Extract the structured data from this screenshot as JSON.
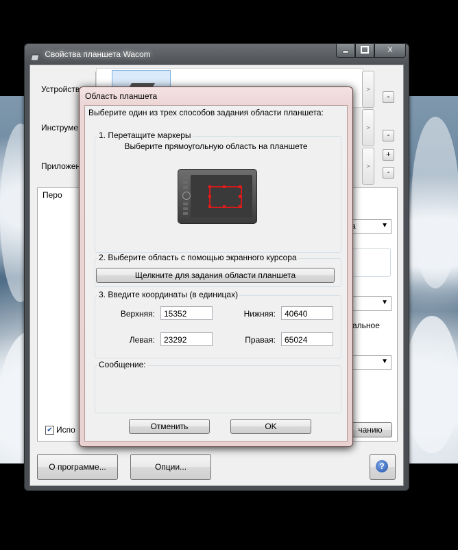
{
  "main_window": {
    "title": "Свойства планшета Wacom",
    "close_label": "X",
    "rows": {
      "device_label": "Устройство",
      "tool_label": "Инструмент",
      "app_label": "Приложение"
    },
    "nav_arrow": ">",
    "minus": "-",
    "plus": "+",
    "tab_pen_label": "Перо",
    "partial_a": "а",
    "partial_normal": "альное",
    "checkbox_checked": true,
    "checkbox_label": "Испо",
    "default_button_label": "чанию",
    "about_button_label": "О программе...",
    "options_button_label": "Опции...",
    "help_symbol": "?"
  },
  "dialog": {
    "title": "Область планшета",
    "intro": "Выберите один из трех способов задания области планшета:",
    "section1": {
      "title": "1. Перетащите маркеры",
      "subtitle": "Выберите прямоугольную область на планшете"
    },
    "section2": {
      "title": "2. Выберите область с помощью экранного курсора",
      "button_label": "Щелкните для задания области планшета"
    },
    "section3": {
      "title": "3. Введите координаты (в единицах)",
      "top_label": "Верхняя:",
      "top_value": "15352",
      "bottom_label": "Нижняя:",
      "bottom_value": "40640",
      "left_label": "Левая:",
      "left_value": "23292",
      "right_label": "Правая:",
      "right_value": "65024"
    },
    "message_label": "Сообщение:",
    "cancel_label": "Отменить",
    "ok_label": "OK"
  },
  "colors": {
    "region_marker": "#d21a1a",
    "dialog_frame": "#ecd6d6",
    "help_icon": "#1f4fa8"
  }
}
